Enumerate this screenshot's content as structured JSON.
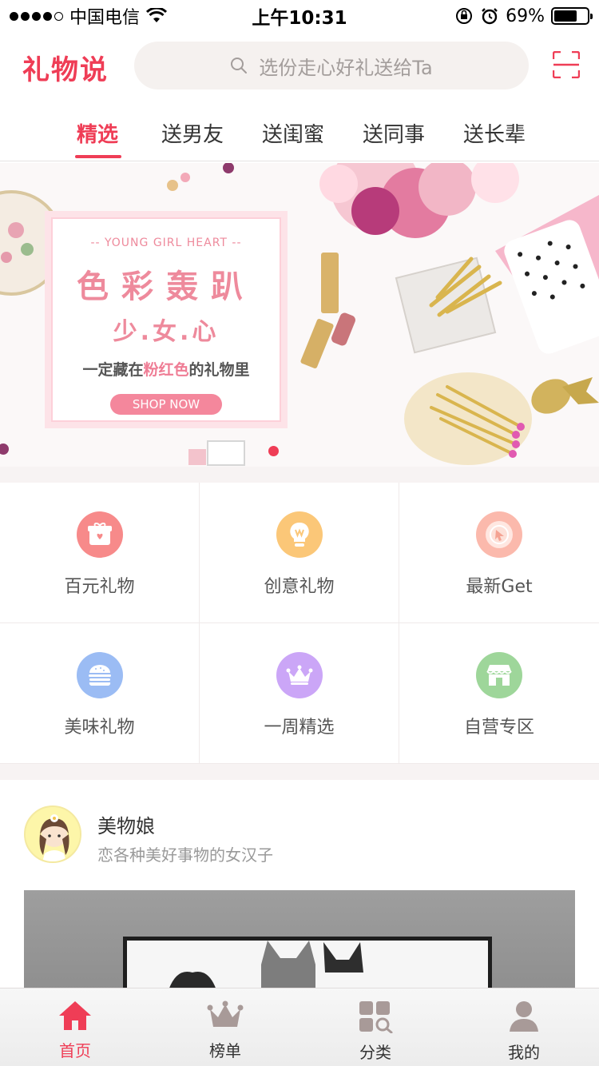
{
  "status_bar": {
    "carrier": "中国电信",
    "time": "上午10:31",
    "battery_percent": "69%",
    "battery_level": 0.69
  },
  "header": {
    "logo": "礼物说",
    "search_placeholder": "选份走心好礼送给Ta",
    "icons": [
      "search-icon",
      "scan-icon"
    ]
  },
  "tabs": [
    {
      "label": "精选",
      "active": true
    },
    {
      "label": "送男友"
    },
    {
      "label": "送闺蜜"
    },
    {
      "label": "送同事"
    },
    {
      "label": "送长辈"
    }
  ],
  "banner": {
    "eyebrow": "-- YOUNG GIRL HEART --",
    "title": "色彩轰趴",
    "subtitle": "少.女.心",
    "line_prefix": "一定藏在",
    "line_highlight": "粉红色",
    "line_suffix": "的礼物里",
    "cta": "SHOP NOW",
    "pagination": {
      "current": 1
    }
  },
  "categories": [
    {
      "label": "百元礼物",
      "icon": "gift-icon",
      "color": "#f78a8a"
    },
    {
      "label": "创意礼物",
      "icon": "lightbulb-icon",
      "color": "#fbc778"
    },
    {
      "label": "最新Get",
      "icon": "cursor-icon",
      "color": "#fbb9ac"
    },
    {
      "label": "美味礼物",
      "icon": "burger-icon",
      "color": "#9bbcf4"
    },
    {
      "label": "一周精选",
      "icon": "crown-icon",
      "color": "#cba6f7"
    },
    {
      "label": "自营专区",
      "icon": "shop-icon",
      "color": "#9ed69a"
    }
  ],
  "feed": {
    "author_name": "美物娘",
    "author_desc": "恋各种美好事物的女汉子"
  },
  "tabbar": [
    {
      "label": "首页",
      "icon": "home-icon",
      "active": true
    },
    {
      "label": "榜单",
      "icon": "crown-icon"
    },
    {
      "label": "分类",
      "icon": "category-icon"
    },
    {
      "label": "我的",
      "icon": "profile-icon"
    }
  ],
  "colors": {
    "accent": "#ef3d56",
    "inactive_icon": "#a89a98"
  }
}
